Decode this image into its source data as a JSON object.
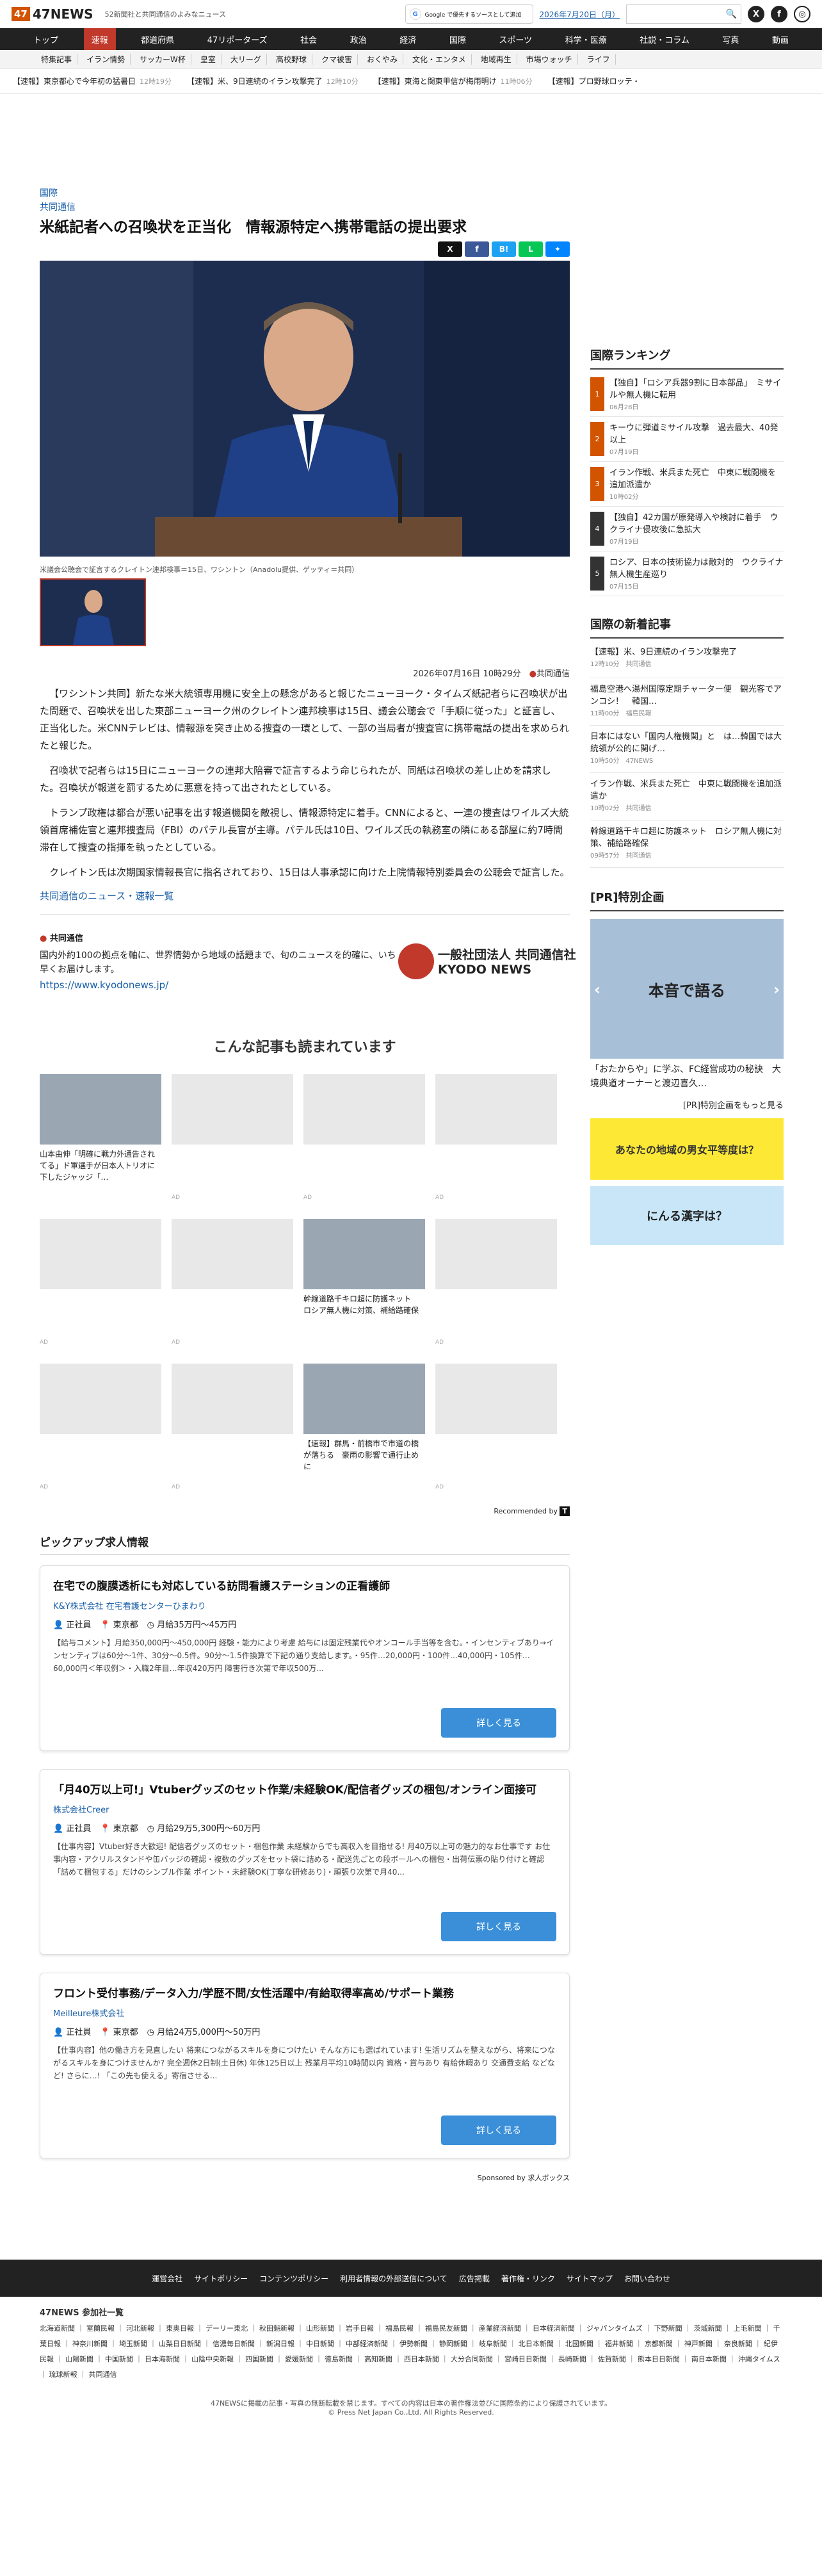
{
  "header": {
    "logo": "47NEWS",
    "tagline": "52新聞社と共同通信のよみなニュース",
    "google": "Google で優先するソースとして追加",
    "date": "2026年7月20日（月）"
  },
  "nav": [
    "トップ",
    "速報",
    "都道府県",
    "47リポーターズ",
    "社会",
    "政治",
    "経済",
    "国際",
    "スポーツ",
    "科学・医療",
    "社説・コラム",
    "写真",
    "動画"
  ],
  "subnav": [
    "特集記事",
    "イラン情勢",
    "サッカーW杯",
    "皇室",
    "大リーグ",
    "高校野球",
    "クマ被害",
    "おくやみ",
    "文化・エンタメ",
    "地域再生",
    "市場ウォッチ",
    "ライフ"
  ],
  "ticker": [
    {
      "t": "【速報】東京都心で今年初の猛暑日",
      "time": "12時19分"
    },
    {
      "t": "【速報】米、9日連続のイラン攻撃完了",
      "time": "12時10分"
    },
    {
      "t": "【速報】東海と関東甲信が梅雨明け",
      "time": "11時06分"
    },
    {
      "t": "【速報】プロ野球ロッテ・",
      "time": ""
    }
  ],
  "article": {
    "section": "国際",
    "source": "共同通信",
    "title": "米紙記者への召喚状を正当化　情報源特定へ携帯電話の提出要求",
    "caption": "米議会公聴会で証言するクレイトン連邦検事＝15日、ワシントン（Anadolu提供、ゲッティ＝共同）",
    "date": "2026年07月16日 10時29分",
    "by": "共同通信",
    "paras": [
      "【ワシントン共同】新たな米大統領専用機に安全上の懸念があると報じたニューヨーク・タイムズ紙記者らに召喚状が出た問題で、召喚状を出した東部ニューヨーク州のクレイトン連邦検事は15日、議会公聴会で「手順に従った」と証言し、正当化した。米CNNテレビは、情報源を突き止める捜査の一環として、一部の当局者が捜査官に携帯電話の提出を求められたと報じた。",
      "召喚状で記者らは15日にニューヨークの連邦大陪審で証言するよう命じられたが、同紙は召喚状の差し止めを請求した。召喚状が報道を罰するために悪意を持って出されたとしている。",
      "トランプ政権は都合が悪い記事を出す報道機関を敵視し、情報源特定に着手。CNNによると、一連の捜査はワイルズ大統領首席補佐官と連邦捜査局（FBI）のパテル長官が主導。パテル氏は10日、ワイルズ氏の執務室の隣にある部屋に約7時間滞在して捜査の指揮を執ったとしている。",
      "クレイトン氏は次期国家情報長官に指名されており、15日は人事承認に向けた上院情報特別委員会の公聴会で証言した。"
    ],
    "more": "共同通信のニュース・速報一覧"
  },
  "kyodo": {
    "name": "共同通信",
    "desc": "国内外約100の拠点を軸に、世界情勢から地域の話題まで、旬のニュースを的確に、いち早くお届けします。",
    "url": "https://www.kyodonews.jp/",
    "logo": "一般社団法人 共同通信社 KYODO NEWS"
  },
  "rec": {
    "title": "こんな記事も読まれています",
    "items": [
      "山本由伸「明確に戦力外通告されてる」ド軍選手が日本人トリオに下したジャッジ「…",
      "",
      "",
      "",
      "",
      "",
      "幹線道路千キロ超に防護ネット　ロシア無人機に対策、補給路確保",
      "",
      "",
      "",
      "【速報】群馬・前橋市で市道の橋が落ちる　豪雨の影響で通行止めに",
      ""
    ],
    "ad": "AD",
    "by": "Recommended by"
  },
  "pickup": {
    "title": "ピックアップ求人情報",
    "sponsor": "Sponsored by 求人ボックス",
    "btn": "詳しく見る",
    "jobs": [
      {
        "h": "在宅での腹膜透析にも対応している訪問看護ステーションの正看護師",
        "co": "K&Y株式会社 在宅看護センターひまわり",
        "type": "正社員",
        "loc": "東京都",
        "pay": "月給35万円〜45万円",
        "ds": "【給与コメント】月給350,000円〜450,000円 経験・能力により考慮 給与には固定残業代やオンコール手当等を含む。・インセンティブあり→インセンティブは60分〜1件、30分〜0.5件。90分〜1.5件換算で下記の通り支給します。・95件…20,000円・100件…40,000円・105件…60,000円＜年収例＞・入職2年目…年収420万円 障害行き次第で年収500万..."
      },
      {
        "h": "「月40万以上可!」Vtuberグッズのセット作業/未経験OK/配信者グッズの梱包/オンライン面接可",
        "co": "株式会社Creer",
        "type": "正社員",
        "loc": "東京都",
        "pay": "月給29万5,300円〜60万円",
        "ds": "【仕事内容】Vtuber好き大歓迎! 配信者グッズのセット・梱包作業 未経験からでも高収入を目指せる! 月40万以上可の魅力的なお仕事です お仕事内容・アクリルスタンドや缶バッジの確認・複数のグッズをセット袋に詰める・配送先ごとの段ボールへの梱包・出荷伝票の貼り付けと確認「詰めて梱包する」だけのシンプル作業 ポイント・未経験OK(丁寧な研修あり)・頑張り次第で月40..."
      },
      {
        "h": "フロント受付事務/データ入力/学歴不問/女性活躍中/有給取得率高め/サポート業務",
        "co": "Meilleure株式会社",
        "type": "正社員",
        "loc": "東京都",
        "pay": "月給24万5,000円〜50万円",
        "ds": "【仕事内容】他の働き方を見直したい 将来につながるスキルを身につけたい そんな方にも選ばれています! 生活リズムを整えながら、将来につながるスキルを身につけませんか? 完全週休2日制(土日休) 年休125日以上 残業月平均10時間以内 資格・賞与あり 有給休暇あり 交通費支給 などなど! さらに…! 「この先も使える」寄宿させる..."
      }
    ]
  },
  "side": {
    "rank_title": "国際ランキング",
    "rank": [
      {
        "t": "【独自】「ロシア兵器9割に日本部品」　ミサイルや無人機に転用",
        "d": "06月28日"
      },
      {
        "t": "キーウに弾道ミサイル攻撃　過去最大、40発以上",
        "d": "07月19日"
      },
      {
        "t": "イラン作戦、米兵また死亡　中東に戦闘機を追加派遣か",
        "d": "10時02分"
      },
      {
        "t": "【独自】42カ国が原発導入や検討に着手　ウクライナ侵攻後に急拡大",
        "d": "07月19日"
      },
      {
        "t": "ロシア、日本の技術協力は敵対的　ウクライナ無人機生産巡り",
        "d": "07月15日"
      }
    ],
    "news_title": "国際の新着記事",
    "news": [
      {
        "t": "【速報】米、9日連続のイラン攻撃完了",
        "s": "12時10分　共同通信"
      },
      {
        "t": "福島空港へ湯州国際定期チャーター便　観光客でアンコシ！　韓国…",
        "s": "11時00分　福島民報"
      },
      {
        "t": "日本にはない「国内人権機関」と　は…韓国では大統領が公的に関げ…",
        "s": "10時50分　47NEWS"
      },
      {
        "t": "イラン作戦、米兵また死亡　中東に戦闘機を追加派遣か",
        "s": "10時02分　共同通信"
      },
      {
        "t": "幹線道路千キロ超に防護ネット　ロシア無人機に対策、補給路確保",
        "s": "09時57分　共同通信"
      }
    ],
    "pr_title": "[PR]特別企画",
    "pr_img": "本音で語る",
    "pr_cap": "「おたからや」に学ぶ、FC経営成功の秘訣　大境典道オーナーと渡辺喜久…",
    "pr_more": "[PR]特別企画をもっと見る",
    "bn1": "あなたの地域の男女平等度は？",
    "bn2": "にんる漢字は？"
  },
  "footer": {
    "links": [
      "運営会社",
      "サイトポリシー",
      "コンテンツポリシー",
      "利用者情報の外部送信について",
      "広告掲載",
      "著作権・リンク",
      "サイトマップ",
      "お問い合わせ"
    ],
    "members_title": "47NEWS 参加社一覧",
    "members": "北海道新聞 ｜ 室蘭民報 ｜ 河北新報 ｜ 東奥日報 ｜ デーリー東北 ｜ 秋田魁新報 ｜ 山形新聞 ｜ 岩手日報 ｜ 福島民報 ｜ 福島民友新聞 ｜ 産業経済新聞 ｜ 日本経済新聞 ｜ ジャパンタイムズ ｜ 下野新聞 ｜ 茨城新聞 ｜ 上毛新聞 ｜ 千葉日報 ｜ 神奈川新聞 ｜ 埼玉新聞 ｜ 山梨日日新聞 ｜ 信濃毎日新聞 ｜ 新潟日報 ｜ 中日新聞 ｜ 中部経済新聞 ｜ 伊勢新聞 ｜ 静岡新聞 ｜ 岐阜新聞 ｜ 北日本新聞 ｜ 北國新聞 ｜ 福井新聞 ｜ 京都新聞 ｜ 神戸新聞 ｜ 奈良新聞 ｜ 紀伊民報 ｜ 山陽新聞 ｜ 中国新聞 ｜ 日本海新聞 ｜ 山陰中央新報 ｜ 四国新聞 ｜ 愛媛新聞 ｜ 徳島新聞 ｜ 高知新聞 ｜ 西日本新聞 ｜ 大分合同新聞 ｜ 宮崎日日新聞 ｜ 長崎新聞 ｜ 佐賀新聞 ｜ 熊本日日新聞 ｜ 南日本新聞 ｜ 沖縄タイムス ｜ 琉球新報 ｜ 共同通信",
    "note": "47NEWSに掲載の記事・写真の無断転載を禁じます。すべての内容は日本の著作権法並びに国際条約により保護されています。",
    "copy": "© Press Net Japan Co.,Ltd. All Rights Reserved."
  }
}
